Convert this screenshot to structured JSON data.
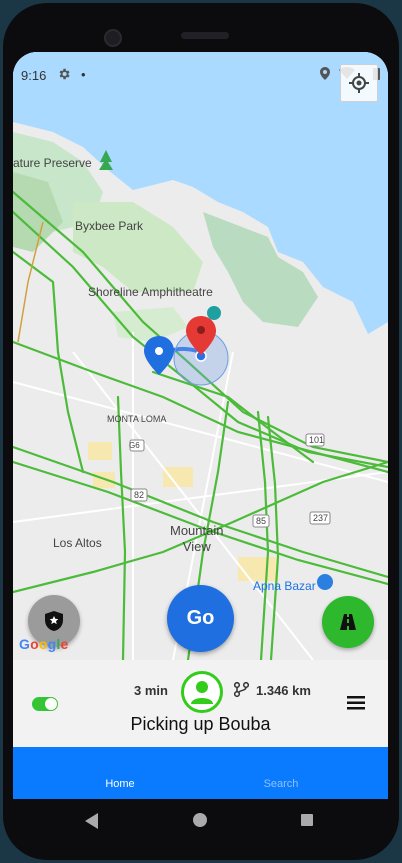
{
  "status_bar": {
    "time": "9:16"
  },
  "map": {
    "labels": {
      "nature_preserve": "ature Preserve",
      "byxbee_park": "Byxbee Park",
      "shoreline": "Shoreline Amphitheatre",
      "monta_loma": "MONTA LOMA",
      "g6": "G6",
      "r82": "82",
      "r85": "85",
      "r101": "101",
      "r237": "237",
      "los_altos": "Los Altos",
      "mountain_view": "Mountain\nView",
      "apna_bazar": "Apna Bazar"
    },
    "google_logo": "Google"
  },
  "actions": {
    "go_label": "Go"
  },
  "trip": {
    "eta": "3 min",
    "distance": "1.346 km",
    "status": "Picking up Bouba",
    "online": true
  },
  "tabs": {
    "home": "Home",
    "search": "Search"
  },
  "colors": {
    "accent": "#0a7bff",
    "go": "#1f6fe0",
    "online": "#33cc1a",
    "traffic": "#4cbb3a"
  }
}
